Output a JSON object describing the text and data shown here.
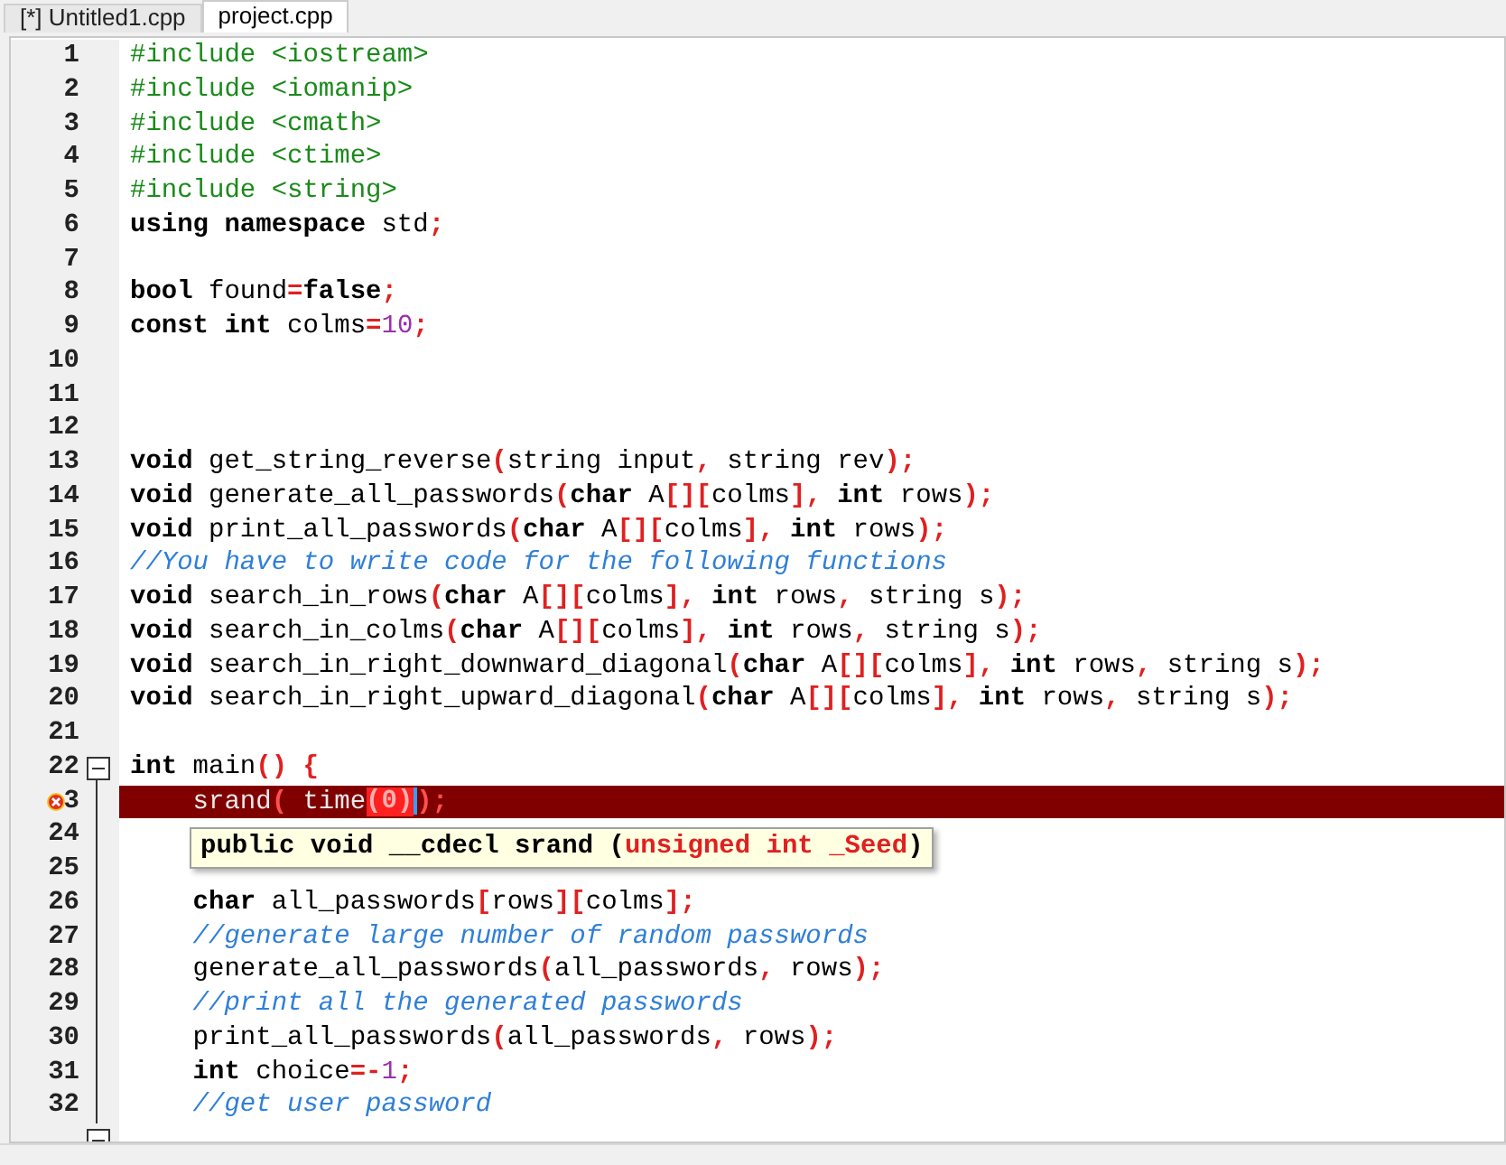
{
  "tabs": [
    {
      "label": "[*] Untitled1.cpp",
      "selected": false
    },
    {
      "label": "project.cpp",
      "selected": true
    }
  ],
  "editor": {
    "lines": [
      {
        "number": "1",
        "tokens": [
          {
            "text": "#include <iostream>",
            "kind": "pre"
          }
        ]
      },
      {
        "number": "2",
        "tokens": [
          {
            "text": "#include <iomanip>",
            "kind": "pre"
          }
        ]
      },
      {
        "number": "3",
        "tokens": [
          {
            "text": "#include <cmath>",
            "kind": "pre"
          }
        ]
      },
      {
        "number": "4",
        "tokens": [
          {
            "text": "#include <ctime>",
            "kind": "pre"
          }
        ]
      },
      {
        "number": "5",
        "tokens": [
          {
            "text": "#include <string>",
            "kind": "pre"
          }
        ]
      },
      {
        "number": "6",
        "tokens": [
          {
            "text": "using namespace",
            "kind": "kw"
          },
          {
            "text": " std",
            "kind": "text"
          },
          {
            "text": ";",
            "kind": "sym"
          }
        ]
      },
      {
        "number": "7"
      },
      {
        "number": "8",
        "tokens": [
          {
            "text": "bool",
            "kind": "kw"
          },
          {
            "text": " found",
            "kind": "text"
          },
          {
            "text": "=",
            "kind": "sym"
          },
          {
            "text": "false",
            "kind": "kw"
          },
          {
            "text": ";",
            "kind": "sym"
          }
        ]
      },
      {
        "number": "9",
        "tokens": [
          {
            "text": "const int",
            "kind": "kw"
          },
          {
            "text": " colms",
            "kind": "text"
          },
          {
            "text": "=",
            "kind": "sym"
          },
          {
            "text": "10",
            "kind": "num"
          },
          {
            "text": ";",
            "kind": "sym"
          }
        ]
      },
      {
        "number": "10"
      },
      {
        "number": "11"
      },
      {
        "number": "12"
      },
      {
        "number": "13",
        "tokens": [
          {
            "text": "void",
            "kind": "kw"
          },
          {
            "text": " get_string_reverse",
            "kind": "text"
          },
          {
            "text": "(",
            "kind": "sym"
          },
          {
            "text": "string input",
            "kind": "text"
          },
          {
            "text": ",",
            "kind": "sym"
          },
          {
            "text": " string rev",
            "kind": "text"
          },
          {
            "text": ");",
            "kind": "sym"
          }
        ]
      },
      {
        "number": "14",
        "tokens": [
          {
            "text": "void",
            "kind": "kw"
          },
          {
            "text": " generate_all_passwords",
            "kind": "text"
          },
          {
            "text": "(",
            "kind": "sym"
          },
          {
            "text": "char",
            "kind": "kw"
          },
          {
            "text": " A",
            "kind": "text"
          },
          {
            "text": "[][",
            "kind": "sym"
          },
          {
            "text": "colms",
            "kind": "text"
          },
          {
            "text": "], ",
            "kind": "sym"
          },
          {
            "text": "int",
            "kind": "kw"
          },
          {
            "text": " rows",
            "kind": "text"
          },
          {
            "text": ");",
            "kind": "sym"
          }
        ]
      },
      {
        "number": "15",
        "tokens": [
          {
            "text": "void",
            "kind": "kw"
          },
          {
            "text": " print_all_passwords",
            "kind": "text"
          },
          {
            "text": "(",
            "kind": "sym"
          },
          {
            "text": "char",
            "kind": "kw"
          },
          {
            "text": " A",
            "kind": "text"
          },
          {
            "text": "[][",
            "kind": "sym"
          },
          {
            "text": "colms",
            "kind": "text"
          },
          {
            "text": "], ",
            "kind": "sym"
          },
          {
            "text": "int",
            "kind": "kw"
          },
          {
            "text": " rows",
            "kind": "text"
          },
          {
            "text": ");",
            "kind": "sym"
          }
        ]
      },
      {
        "number": "16",
        "tokens": [
          {
            "text": "//You have to write code for the following functions",
            "kind": "cmt"
          }
        ]
      },
      {
        "number": "17",
        "tokens": [
          {
            "text": "void",
            "kind": "kw"
          },
          {
            "text": " search_in_rows",
            "kind": "text"
          },
          {
            "text": "(",
            "kind": "sym"
          },
          {
            "text": "char",
            "kind": "kw"
          },
          {
            "text": " A",
            "kind": "text"
          },
          {
            "text": "[][",
            "kind": "sym"
          },
          {
            "text": "colms",
            "kind": "text"
          },
          {
            "text": "], ",
            "kind": "sym"
          },
          {
            "text": "int",
            "kind": "kw"
          },
          {
            "text": " rows",
            "kind": "text"
          },
          {
            "text": ",",
            "kind": "sym"
          },
          {
            "text": " string s",
            "kind": "text"
          },
          {
            "text": ");",
            "kind": "sym"
          }
        ]
      },
      {
        "number": "18",
        "tokens": [
          {
            "text": "void",
            "kind": "kw"
          },
          {
            "text": " search_in_colms",
            "kind": "text"
          },
          {
            "text": "(",
            "kind": "sym"
          },
          {
            "text": "char",
            "kind": "kw"
          },
          {
            "text": " A",
            "kind": "text"
          },
          {
            "text": "[][",
            "kind": "sym"
          },
          {
            "text": "colms",
            "kind": "text"
          },
          {
            "text": "], ",
            "kind": "sym"
          },
          {
            "text": "int",
            "kind": "kw"
          },
          {
            "text": " rows",
            "kind": "text"
          },
          {
            "text": ",",
            "kind": "sym"
          },
          {
            "text": " string s",
            "kind": "text"
          },
          {
            "text": ");",
            "kind": "sym"
          }
        ]
      },
      {
        "number": "19",
        "tokens": [
          {
            "text": "void",
            "kind": "kw"
          },
          {
            "text": " search_in_right_downward_diagonal",
            "kind": "text"
          },
          {
            "text": "(",
            "kind": "sym"
          },
          {
            "text": "char",
            "kind": "kw"
          },
          {
            "text": " A",
            "kind": "text"
          },
          {
            "text": "[][",
            "kind": "sym"
          },
          {
            "text": "colms",
            "kind": "text"
          },
          {
            "text": "], ",
            "kind": "sym"
          },
          {
            "text": "int",
            "kind": "kw"
          },
          {
            "text": " rows",
            "kind": "text"
          },
          {
            "text": ",",
            "kind": "sym"
          },
          {
            "text": " string s",
            "kind": "text"
          },
          {
            "text": ");",
            "kind": "sym"
          }
        ]
      },
      {
        "number": "20",
        "tokens": [
          {
            "text": "void",
            "kind": "kw"
          },
          {
            "text": " search_in_right_upward_diagonal",
            "kind": "text"
          },
          {
            "text": "(",
            "kind": "sym"
          },
          {
            "text": "char",
            "kind": "kw"
          },
          {
            "text": " A",
            "kind": "text"
          },
          {
            "text": "[][",
            "kind": "sym"
          },
          {
            "text": "colms",
            "kind": "text"
          },
          {
            "text": "], ",
            "kind": "sym"
          },
          {
            "text": "int",
            "kind": "kw"
          },
          {
            "text": " rows",
            "kind": "text"
          },
          {
            "text": ",",
            "kind": "sym"
          },
          {
            "text": " string s",
            "kind": "text"
          },
          {
            "text": ");",
            "kind": "sym"
          }
        ]
      },
      {
        "number": "21"
      },
      {
        "number": "22",
        "fold_start": true,
        "tokens": [
          {
            "text": "int",
            "kind": "kw"
          },
          {
            "text": " main",
            "kind": "text"
          },
          {
            "text": "() {",
            "kind": "sym"
          }
        ]
      },
      {
        "number": "3",
        "fold_line": true,
        "error": true,
        "tokens": [
          {
            "text": "    srand",
            "kind": "text"
          },
          {
            "text": "(",
            "kind": "sym"
          },
          {
            "text": " time",
            "kind": "text"
          },
          {
            "text": "(0)",
            "kind": "match"
          },
          {
            "text": ");",
            "kind": "sym"
          }
        ]
      },
      {
        "number": "24",
        "fold_line": true
      },
      {
        "number": "25",
        "fold_line": true
      },
      {
        "number": "26",
        "fold_line": true,
        "tokens": [
          {
            "text": "    char",
            "kind": "kw"
          },
          {
            "text": " all_passwords",
            "kind": "text"
          },
          {
            "text": "[",
            "kind": "sym"
          },
          {
            "text": "rows",
            "kind": "text"
          },
          {
            "text": "][",
            "kind": "sym"
          },
          {
            "text": "colms",
            "kind": "text"
          },
          {
            "text": "];",
            "kind": "sym"
          }
        ]
      },
      {
        "number": "27",
        "fold_line": true,
        "tokens": [
          {
            "text": "    //generate large number of random passwords",
            "kind": "cmt"
          }
        ]
      },
      {
        "number": "28",
        "fold_line": true,
        "tokens": [
          {
            "text": "    generate_all_passwords",
            "kind": "text"
          },
          {
            "text": "(",
            "kind": "sym"
          },
          {
            "text": "all_passwords",
            "kind": "text"
          },
          {
            "text": ",",
            "kind": "sym"
          },
          {
            "text": " rows",
            "kind": "text"
          },
          {
            "text": ");",
            "kind": "sym"
          }
        ]
      },
      {
        "number": "29",
        "fold_line": true,
        "tokens": [
          {
            "text": "    //print all the generated passwords",
            "kind": "cmt"
          }
        ]
      },
      {
        "number": "30",
        "fold_line": true,
        "tokens": [
          {
            "text": "    print_all_passwords",
            "kind": "text"
          },
          {
            "text": "(",
            "kind": "sym"
          },
          {
            "text": "all_passwords",
            "kind": "text"
          },
          {
            "text": ",",
            "kind": "sym"
          },
          {
            "text": " rows",
            "kind": "text"
          },
          {
            "text": ");",
            "kind": "sym"
          }
        ]
      },
      {
        "number": "31",
        "fold_line": true,
        "tokens": [
          {
            "text": "    int",
            "kind": "kw"
          },
          {
            "text": " choice",
            "kind": "text"
          },
          {
            "text": "=-",
            "kind": "sym"
          },
          {
            "text": "1",
            "kind": "num"
          },
          {
            "text": ";",
            "kind": "sym"
          }
        ]
      },
      {
        "number": "32",
        "fold_line": true,
        "tokens": [
          {
            "text": "    //get user password",
            "kind": "cmt"
          }
        ]
      },
      {
        "fold_start": true
      }
    ],
    "tooltip": {
      "tokens": [
        {
          "text": "public void __cdecl srand (",
          "kind": "text"
        },
        {
          "text": "unsigned int _Seed",
          "kind": "sym"
        },
        {
          "text": ")",
          "kind": "text"
        }
      ]
    }
  }
}
